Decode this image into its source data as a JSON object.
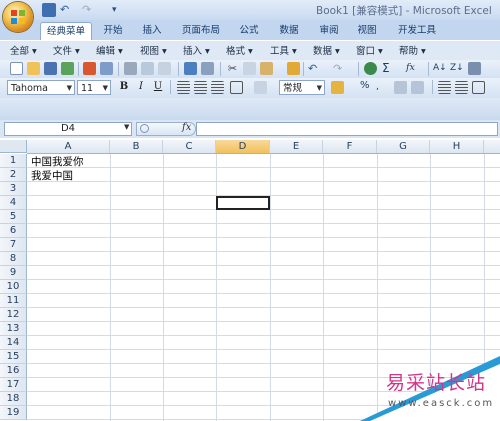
{
  "window": {
    "title": "Book1 [兼容模式] - Microsoft Excel"
  },
  "tabs": [
    {
      "label": "经典菜单",
      "active": true
    },
    {
      "label": "开始"
    },
    {
      "label": "插入"
    },
    {
      "label": "页面布局"
    },
    {
      "label": "公式"
    },
    {
      "label": "数据"
    },
    {
      "label": "审阅"
    },
    {
      "label": "视图"
    },
    {
      "label": "开发工具"
    }
  ],
  "menus": [
    "全部 ▾",
    "文件 ▾",
    "编辑 ▾",
    "视图 ▾",
    "插入 ▾",
    "格式 ▾",
    "工具 ▾",
    "数据 ▾",
    "窗口 ▾",
    "帮助 ▾"
  ],
  "toolbar": {
    "font_name": "Tahoma",
    "font_size": "11",
    "bold": "B",
    "italic": "I",
    "underline": "U",
    "number_format": "常规",
    "percent": "%",
    "sigma": "Σ",
    "fx_small": "fx"
  },
  "formula_bar": {
    "name_box": "D4",
    "fx_label": "fx",
    "formula": ""
  },
  "columns": [
    "A",
    "B",
    "C",
    "D",
    "E",
    "F",
    "G",
    "H"
  ],
  "selected_column": "D",
  "rows": [
    "1",
    "2",
    "3",
    "4",
    "5",
    "6",
    "7",
    "8",
    "9",
    "10",
    "11",
    "12",
    "13",
    "14",
    "15",
    "16",
    "17",
    "18",
    "19"
  ],
  "cells": {
    "A1": "中国我爱你",
    "A2": "我爱中国"
  },
  "watermark": {
    "text": "易采站长站",
    "url": "www.easck.com"
  },
  "colors": {
    "accent": "#c2d6ef",
    "grid": "#d4dbe6",
    "selection": "#f1c05c"
  }
}
